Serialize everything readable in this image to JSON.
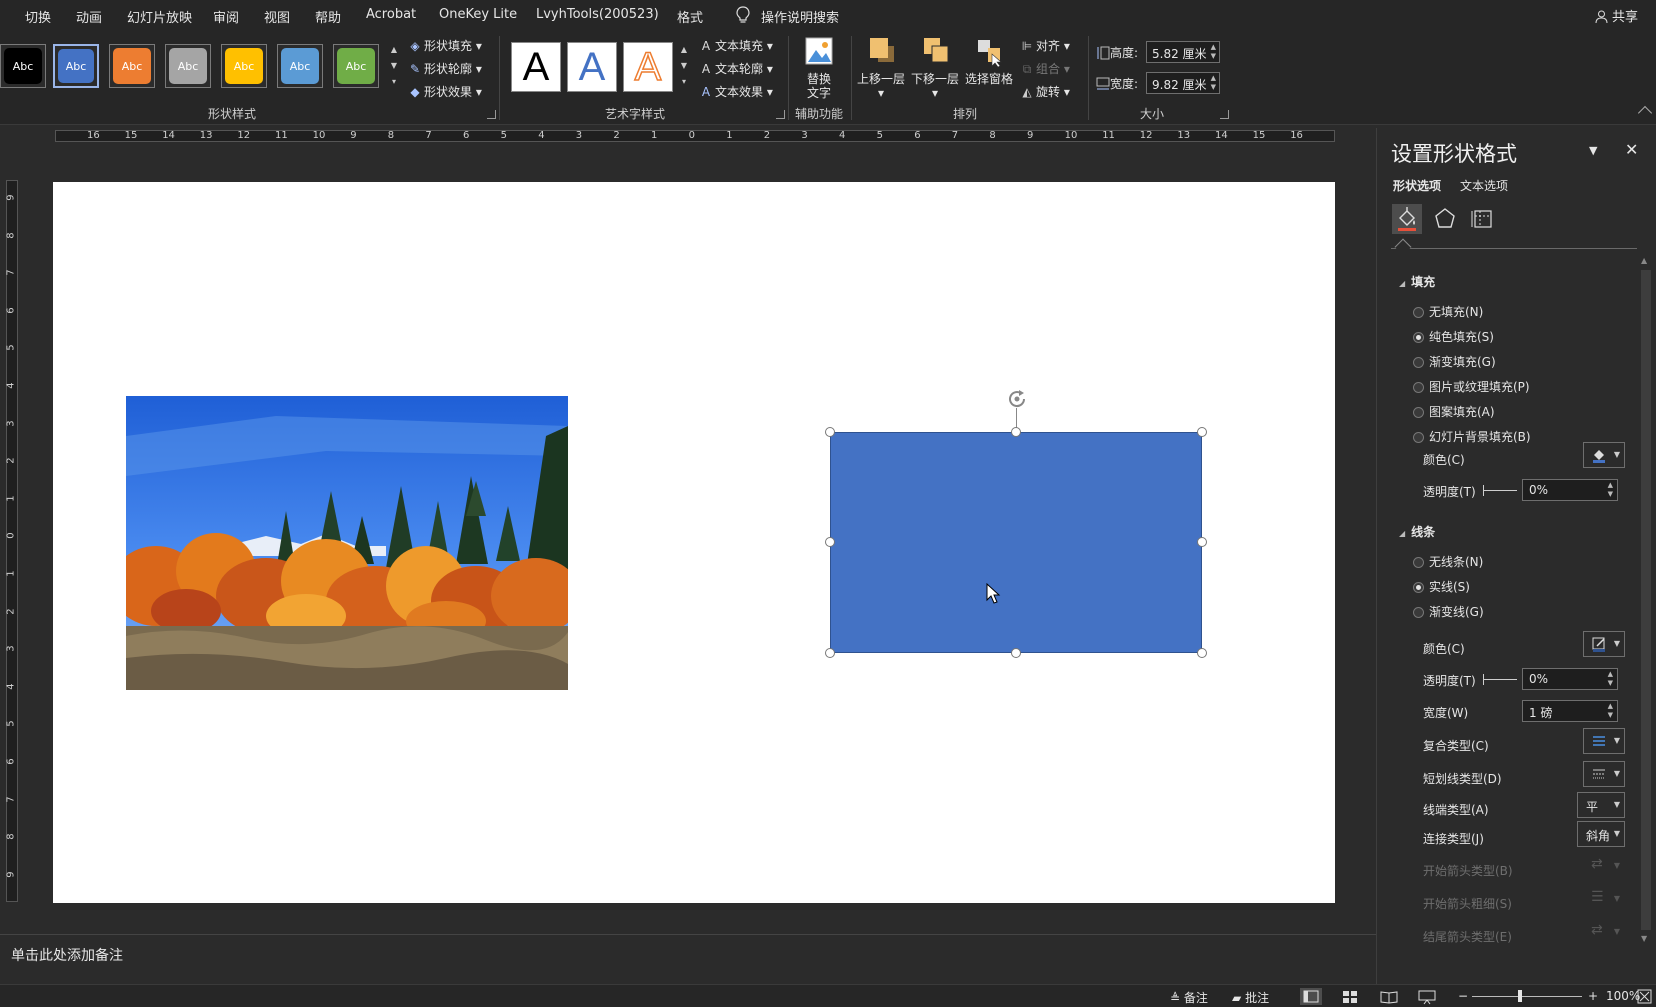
{
  "menu": {
    "items": [
      "切换",
      "动画",
      "幻灯片放映",
      "审阅",
      "视图",
      "帮助",
      "Acrobat",
      "OneKey Lite",
      "LvyhTools(200523)",
      "格式"
    ],
    "search_label": "操作说明搜索",
    "share_label": "共享"
  },
  "ribbon": {
    "shape_styles": {
      "label": "形状样式",
      "swatches": [
        {
          "text": "Abc",
          "color": "#000000"
        },
        {
          "text": "Abc",
          "color": "#4472c4"
        },
        {
          "text": "Abc",
          "color": "#ed7d31"
        },
        {
          "text": "Abc",
          "color": "#a5a5a5"
        },
        {
          "text": "Abc",
          "color": "#ffc000"
        },
        {
          "text": "Abc",
          "color": "#5b9bd5"
        },
        {
          "text": "Abc",
          "color": "#70ad47"
        }
      ],
      "fill_label": "形状填充",
      "outline_label": "形状轮廓",
      "effect_label": "形状效果"
    },
    "wordart": {
      "label": "艺术字样式",
      "sample": "A",
      "fill_label": "文本填充",
      "outline_label": "文本轮廓",
      "effect_label": "文本效果",
      "text_icon": "A"
    },
    "accessibility": {
      "label": "辅助功能",
      "alt_text_line1": "替换",
      "alt_text_line2": "文字"
    },
    "arrange": {
      "label": "排列",
      "bring_forward": "上移一层",
      "send_backward": "下移一层",
      "selection_pane": "选择窗格",
      "align": "对齐",
      "group": "组合",
      "rotate": "旋转"
    },
    "size": {
      "label": "大小",
      "height_label": "高度:",
      "height_value": "5.82 厘米",
      "width_label": "宽度:",
      "width_value": "9.82 厘米"
    }
  },
  "ruler": {
    "h_numbers": [
      "16",
      "15",
      "14",
      "13",
      "12",
      "11",
      "10",
      "9",
      "8",
      "7",
      "6",
      "5",
      "4",
      "3",
      "2",
      "1",
      "0",
      "1",
      "2",
      "3",
      "4",
      "5",
      "6",
      "7",
      "8",
      "9",
      "10",
      "11",
      "12",
      "13",
      "14",
      "15",
      "16"
    ],
    "v_numbers": [
      "9",
      "8",
      "7",
      "6",
      "5",
      "4",
      "3",
      "2",
      "1",
      "0",
      "1",
      "2",
      "3",
      "4",
      "5",
      "6",
      "7",
      "8",
      "9"
    ]
  },
  "notes": {
    "placeholder": "单击此处添加备注"
  },
  "pane": {
    "title": "设置形状格式",
    "tab_shape": "形状选项",
    "tab_text": "文本选项",
    "fill": {
      "header": "填充",
      "options": [
        {
          "label": "无填充(N)",
          "checked": false
        },
        {
          "label": "纯色填充(S)",
          "checked": true
        },
        {
          "label": "渐变填充(G)",
          "checked": false
        },
        {
          "label": "图片或纹理填充(P)",
          "checked": false
        },
        {
          "label": "图案填充(A)",
          "checked": false
        },
        {
          "label": "幻灯片背景填充(B)",
          "checked": false
        }
      ],
      "color_label": "颜色(C)",
      "transparency_label": "透明度(T)",
      "transparency_value": "0%"
    },
    "line": {
      "header": "线条",
      "options": [
        {
          "label": "无线条(N)",
          "checked": false
        },
        {
          "label": "实线(S)",
          "checked": true
        },
        {
          "label": "渐变线(G)",
          "checked": false
        }
      ],
      "color_label": "颜色(C)",
      "transparency_label": "透明度(T)",
      "transparency_value": "0%",
      "width_label": "宽度(W)",
      "width_value": "1 磅",
      "compound_label": "复合类型(C)",
      "dash_label": "短划线类型(D)",
      "cap_label": "线端类型(A)",
      "cap_value": "平",
      "join_label": "连接类型(J)",
      "join_value": "斜角",
      "begin_arrow_type": "开始箭头类型(B)",
      "begin_arrow_size": "开始箭头粗细(S)",
      "end_arrow_type": "结尾箭头类型(E)"
    }
  },
  "status": {
    "notes_label": "备注",
    "comments_label": "批注",
    "zoom_minus": "−",
    "zoom_plus": "+",
    "zoom_value": "100%"
  },
  "colors": {
    "shape_fill": "#4472c4",
    "background": "#2b2b2b",
    "slide": "#ffffff"
  }
}
